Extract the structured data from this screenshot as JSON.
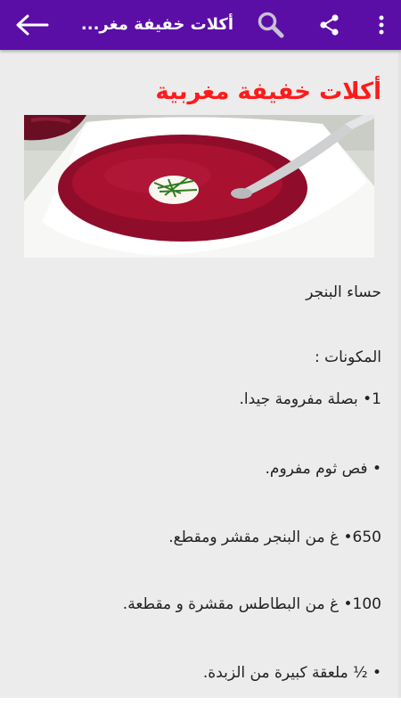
{
  "app_bar": {
    "title": "أكلات خفيفة مغر...",
    "back_icon": "arrow-left-icon",
    "search_icon": "search-icon",
    "share_icon": "share-icon",
    "more_icon": "more-vert-icon",
    "background": "#5a0ea6"
  },
  "article": {
    "heading": "أكلات خفيفة مغربية",
    "heading_color": "#ff1a1a",
    "image_subject": "beetroot soup",
    "dish_name": "حساء البنجر",
    "ingredients_label": "المكونات :",
    "ingredients": [
      "1• بصلة مفرومة جيدا.",
      "• فص ثوم مفروم.",
      "650• غ من البنجر مقشر ومقطع.",
      "100• غ من البطاطس مقشرة و مقطعة.",
      "• ½ ملعقة كبيرة من الزبدة."
    ]
  }
}
